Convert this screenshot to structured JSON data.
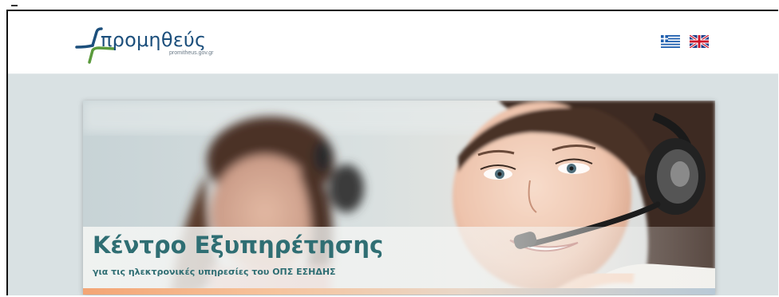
{
  "header": {
    "logo_text": "προμηθεύς",
    "logo_subtext": "promitheus.gov.gr",
    "languages": [
      {
        "code": "el",
        "icon": "greek-flag-icon"
      },
      {
        "code": "en",
        "icon": "uk-flag-icon"
      }
    ]
  },
  "banner": {
    "title": "Κέντρο Εξυπηρέτησης",
    "subtitle": "για τις ηλεκτρονικές υπηρεσίες του ΟΠΣ ΕΣΗΔΗΣ"
  },
  "colors": {
    "logo_blue": "#1c4f7c",
    "logo_green": "#5a9a3c",
    "caption_teal": "#2f6e73",
    "page_background": "#d9e1e3"
  }
}
